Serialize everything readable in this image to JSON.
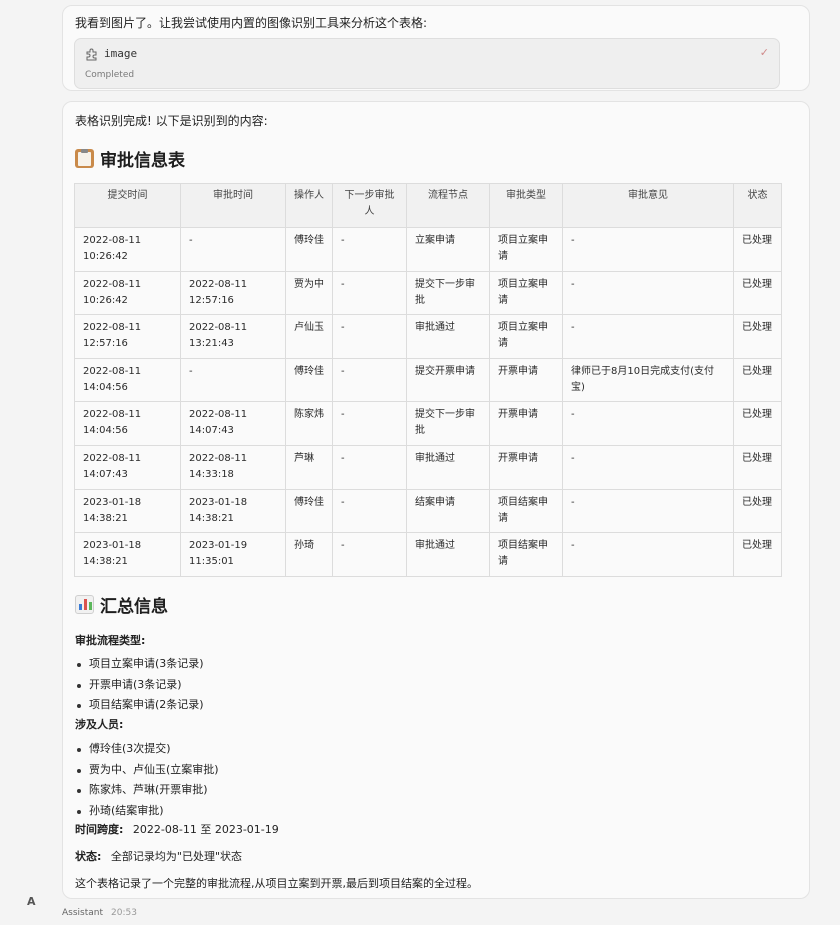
{
  "message1": {
    "text": "我看到图片了。让我尝试使用内置的图像识别工具来分析这个表格:",
    "tool": {
      "name": "image",
      "status": "Completed",
      "icon": "puzzle-icon",
      "check_icon": "check-icon"
    }
  },
  "message2": {
    "intro": "表格识别完成! 以下是识别到的内容:",
    "heading1": "审批信息表",
    "heading2": "汇总信息",
    "table": {
      "headers": [
        "提交时间",
        "审批时间",
        "操作人",
        "下一步审批人",
        "流程节点",
        "审批类型",
        "审批意见",
        "状态"
      ],
      "rows": [
        [
          "2022-08-11 10:26:42",
          "-",
          "傅玲佳",
          "-",
          "立案申请",
          "项目立案申请",
          "-",
          "已处理"
        ],
        [
          "2022-08-11 10:26:42",
          "2022-08-11 12:57:16",
          "贾为中",
          "-",
          "提交下一步审批",
          "项目立案申请",
          "-",
          "已处理"
        ],
        [
          "2022-08-11 12:57:16",
          "2022-08-11 13:21:43",
          "卢仙玉",
          "-",
          "审批通过",
          "项目立案申请",
          "-",
          "已处理"
        ],
        [
          "2022-08-11 14:04:56",
          "-",
          "傅玲佳",
          "-",
          "提交开票申请",
          "开票申请",
          "律师已于8月10日完成支付(支付宝)",
          "已处理"
        ],
        [
          "2022-08-11 14:04:56",
          "2022-08-11 14:07:43",
          "陈家炜",
          "-",
          "提交下一步审批",
          "开票申请",
          "-",
          "已处理"
        ],
        [
          "2022-08-11 14:07:43",
          "2022-08-11 14:33:18",
          "芦琳",
          "-",
          "审批通过",
          "开票申请",
          "-",
          "已处理"
        ],
        [
          "2023-01-18 14:38:21",
          "2023-01-18 14:38:21",
          "傅玲佳",
          "-",
          "结案申请",
          "项目结案申请",
          "-",
          "已处理"
        ],
        [
          "2023-01-18 14:38:21",
          "2023-01-19 11:35:01",
          "孙琦",
          "-",
          "审批通过",
          "项目结案申请",
          "-",
          "已处理"
        ]
      ]
    },
    "summary": {
      "types_label": "审批流程类型:",
      "types": [
        "项目立案申请(3条记录)",
        "开票申请(3条记录)",
        "项目结案申请(2条记录)"
      ],
      "people_label": "涉及人员:",
      "people": [
        "傅玲佳(3次提交)",
        "贾为中、卢仙玉(立案审批)",
        "陈家炜、芦琳(开票审批)",
        "孙琦(结案审批)"
      ],
      "span_label": "时间跨度:",
      "span_value": "2022-08-11 至 2023-01-19",
      "status_label": "状态:",
      "status_value": "全部记录均为\"已处理\"状态",
      "conclusion": "这个表格记录了一个完整的审批流程,从项目立案到开票,最后到项目结案的全过程。"
    }
  },
  "footer": {
    "avatar": "A",
    "role": "Assistant",
    "time": "20:53"
  },
  "icons": {
    "heading1": "clipboard-icon",
    "heading2": "bar-chart-icon"
  }
}
